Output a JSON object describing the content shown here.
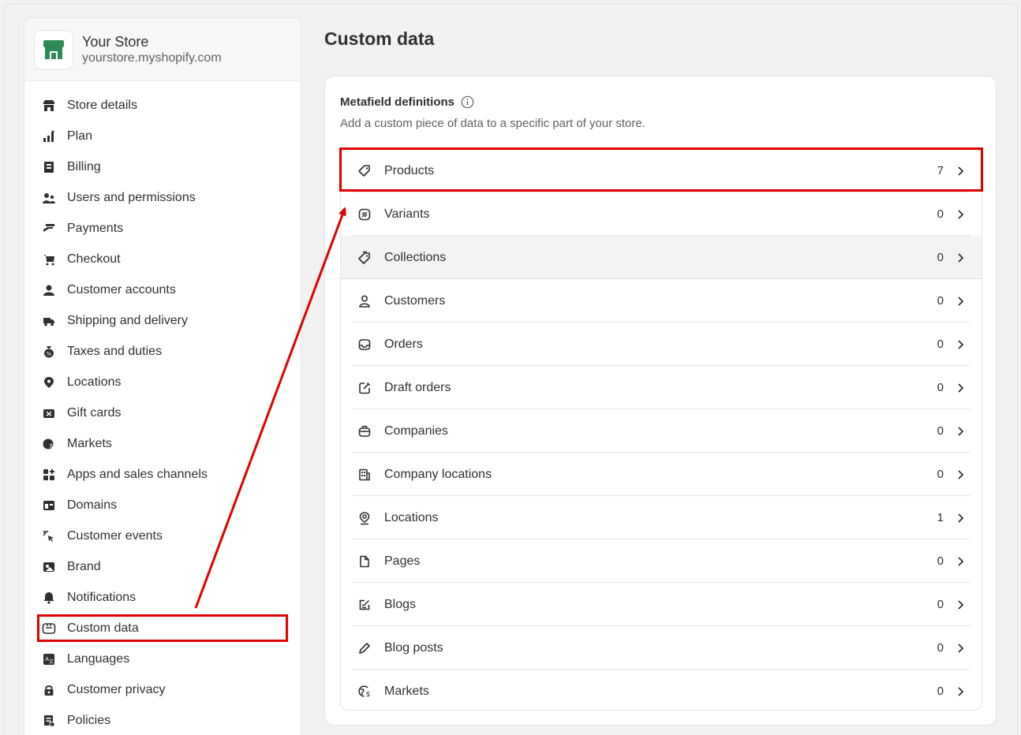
{
  "store": {
    "name": "Your Store",
    "domain": "yourstore.myshopify.com",
    "brand_color": "#2e8b57"
  },
  "sidebar": {
    "items": [
      {
        "label": "Store details",
        "icon": "store-icon"
      },
      {
        "label": "Plan",
        "icon": "plan-chart-icon"
      },
      {
        "label": "Billing",
        "icon": "receipt-icon"
      },
      {
        "label": "Users and permissions",
        "icon": "users-icon"
      },
      {
        "label": "Payments",
        "icon": "payments-hand-icon"
      },
      {
        "label": "Checkout",
        "icon": "cart-icon"
      },
      {
        "label": "Customer accounts",
        "icon": "person-icon"
      },
      {
        "label": "Shipping and delivery",
        "icon": "truck-icon"
      },
      {
        "label": "Taxes and duties",
        "icon": "tax-bag-icon"
      },
      {
        "label": "Locations",
        "icon": "location-pin-icon"
      },
      {
        "label": "Gift cards",
        "icon": "gift-card-icon"
      },
      {
        "label": "Markets",
        "icon": "globe-currency-icon"
      },
      {
        "label": "Apps and sales channels",
        "icon": "apps-icon"
      },
      {
        "label": "Domains",
        "icon": "domains-icon"
      },
      {
        "label": "Customer events",
        "icon": "cursor-click-icon"
      },
      {
        "label": "Brand",
        "icon": "brand-icon"
      },
      {
        "label": "Notifications",
        "icon": "bell-icon"
      },
      {
        "label": "Custom data",
        "icon": "custom-data-icon",
        "active": true
      },
      {
        "label": "Languages",
        "icon": "translate-icon"
      },
      {
        "label": "Customer privacy",
        "icon": "lock-icon"
      },
      {
        "label": "Policies",
        "icon": "policies-icon"
      }
    ]
  },
  "main": {
    "title": "Custom data",
    "card": {
      "title": "Metafield definitions",
      "description": "Add a custom piece of data to a specific part of your store.",
      "rows": [
        {
          "label": "Products",
          "count": "7",
          "icon": "tag-icon"
        },
        {
          "label": "Variants",
          "count": "0",
          "icon": "variants-tag-icon"
        },
        {
          "label": "Collections",
          "count": "0",
          "icon": "collections-tag-icon"
        },
        {
          "label": "Customers",
          "count": "0",
          "icon": "person-outline-icon"
        },
        {
          "label": "Orders",
          "count": "0",
          "icon": "inbox-icon"
        },
        {
          "label": "Draft orders",
          "count": "0",
          "icon": "draft-order-icon"
        },
        {
          "label": "Companies",
          "count": "0",
          "icon": "briefcase-icon"
        },
        {
          "label": "Company locations",
          "count": "0",
          "icon": "building-icon"
        },
        {
          "label": "Locations",
          "count": "1",
          "icon": "location-outline-icon"
        },
        {
          "label": "Pages",
          "count": "0",
          "icon": "page-icon"
        },
        {
          "label": "Blogs",
          "count": "0",
          "icon": "blog-icon"
        },
        {
          "label": "Blog posts",
          "count": "0",
          "icon": "pencil-icon"
        },
        {
          "label": "Markets",
          "count": "0",
          "icon": "globe-outline-icon"
        }
      ]
    }
  },
  "annotation_color": "#e00000"
}
